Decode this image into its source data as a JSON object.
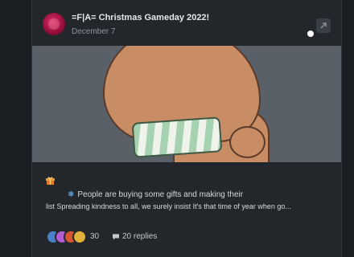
{
  "post": {
    "title": "=F|A= Christmas Gameday 2022!",
    "date": "December 7",
    "line1": "People are buying some gifts and making their",
    "line2": "list Spreading kindness to all, we surely insist It's that time of year when go...",
    "reaction_count": "30",
    "replies": "20 replies"
  },
  "icons": {
    "gift": "gift-icon",
    "snowflake": "snowflake-icon",
    "share": "share-icon",
    "comment": "comment-icon"
  },
  "colors": {
    "background": "#1b1e22",
    "card": "#23272c",
    "banner_bg": "#5a6068",
    "text": "#d6d9dc",
    "muted": "#8d939a"
  }
}
